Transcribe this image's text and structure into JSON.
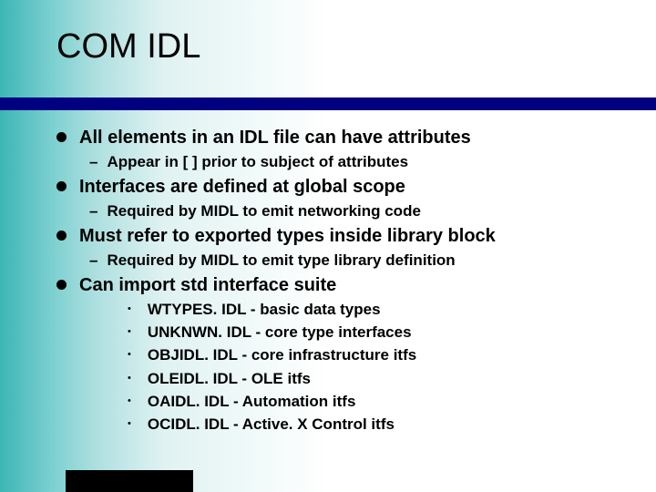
{
  "title": "COM IDL",
  "bullets": [
    {
      "text": "All elements in an IDL file can have attributes",
      "subs": [
        {
          "type": "dash",
          "text": "Appear in [ ] prior to subject of attributes"
        }
      ]
    },
    {
      "text": "Interfaces are defined at global scope",
      "subs": [
        {
          "type": "dash",
          "text": "Required by MIDL to emit networking code"
        }
      ]
    },
    {
      "text": "Must refer to exported types inside library block",
      "subs": [
        {
          "type": "dash",
          "text": "Required by MIDL to emit type library definition"
        }
      ]
    },
    {
      "text": "Can import std interface suite",
      "subs": [
        {
          "type": "dot",
          "text": "WTYPES. IDL - basic data types"
        },
        {
          "type": "dot",
          "text": "UNKNWN. IDL - core type interfaces"
        },
        {
          "type": "dot",
          "text": "OBJIDL. IDL - core infrastructure itfs"
        },
        {
          "type": "dot",
          "text": "OLEIDL. IDL - OLE itfs"
        },
        {
          "type": "dot",
          "text": "OAIDL. IDL  - Automation itfs"
        },
        {
          "type": "dot",
          "text": "OCIDL. IDL  - Active. X Control itfs"
        }
      ]
    }
  ]
}
